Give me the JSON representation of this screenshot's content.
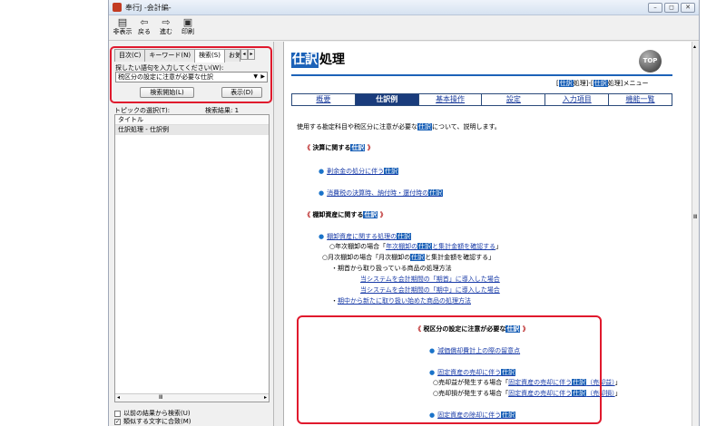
{
  "window": {
    "title": "奉行J -会計編-",
    "controls": {
      "minimize": "–",
      "restore": "◻",
      "close": "✕"
    }
  },
  "toolbar": [
    {
      "label": "非表示",
      "icon": "hide-icon",
      "glyph": "▤"
    },
    {
      "label": "戻る",
      "icon": "back-arrow-icon",
      "glyph": "⇦"
    },
    {
      "label": "進む",
      "icon": "forward-arrow-icon",
      "glyph": "⇨"
    },
    {
      "label": "印刷",
      "icon": "printer-icon",
      "glyph": "▣"
    }
  ],
  "left_pane": {
    "tabs": [
      {
        "label": "目次(C)"
      },
      {
        "label": "キーワード(N)"
      },
      {
        "label": "検索(S)"
      },
      {
        "label": "お気"
      }
    ],
    "tab_scroll": {
      "left": "◂",
      "right": "▸"
    },
    "search_prompt": "探したい語句を入力してください(W):",
    "search_value": "税区分の設定に注意が必要な仕訳",
    "combo_arrow": "▼",
    "combo_side": "▶",
    "search_start_button": "検索開始(L)",
    "display_button": "表示(D)",
    "topic_select_label": "トピックの選択(T):",
    "result_count": "検索結果: 1",
    "list_header": "タイトル",
    "results": [
      "仕訳処理 - 仕訳例"
    ],
    "hscroll": {
      "left": "◂",
      "middle": "Ⅲ",
      "right": "▸"
    },
    "check_prev": "以前の結果から検索(U)",
    "check_similar": "類似する文字に合致(M)",
    "check_prev_mark": "",
    "check_similar_mark": "✓"
  },
  "page": {
    "title_highlight": "仕訳",
    "title_rest": "処理",
    "top_icon": "TOP",
    "crumb": {
      "open": "[",
      "hl1": "仕訳",
      "mid": "処理]-[",
      "hl2": "仕訳",
      "close": "処理]メニュー"
    },
    "nav_tabs": [
      "概要",
      "仕訳例",
      "基本操作",
      "設定",
      "入力項目",
      "機能一覧"
    ],
    "intro": {
      "pre": "使用する勘定科目や税区分に注意が必要な",
      "hl": "仕訳",
      "post": "について、説明します。"
    },
    "sec1": {
      "open": "《",
      "title": "決算に関する",
      "hl": "仕訳",
      "close": "》"
    },
    "sec1_links": [
      {
        "bullet": "●",
        "pre": "剰余金の処分に伴う",
        "hl": "仕訳",
        "post": ""
      },
      {
        "bullet": "●",
        "pre": "消費税の決算時、納付時・還付時の",
        "hl": "仕訳",
        "post": ""
      }
    ],
    "sec2": {
      "open": "《",
      "title": "棚卸資産に関する",
      "hl": "仕訳",
      "close": "》"
    },
    "sec2_items": {
      "main": {
        "bullet": "●",
        "pre": "棚卸資産に関する処理の",
        "hl": "仕訳",
        "post": ""
      },
      "annual": {
        "pre": "○年次棚卸の場合「",
        "link_pre": "年次棚卸の",
        "hl": "仕訳",
        "link_post": "と集計金額を確認する",
        "post": "」"
      },
      "monthly": {
        "pre": "○月次棚卸の場合「月次棚卸の",
        "hl": "仕訳",
        "post": "と集計金額を確認する」"
      },
      "begin": "・期首から取り扱っている商品の処理方法",
      "intro_start": "当システムを会計期間の「期首」に導入した場合",
      "intro_mid": "当システムを会計期間の「期中」に導入した場合",
      "new_items": {
        "pre": "・",
        "link": "期中から新たに取り扱い始めた商品の処理方法"
      }
    },
    "sec3": {
      "open": "《",
      "title": "税区分の設定に注意が必要な",
      "hl": "仕訳",
      "close": "》"
    },
    "sec3_items": {
      "depreciation": {
        "bullet": "●",
        "text": "減価償却費計上の際の留意点"
      },
      "sale": {
        "bullet": "●",
        "pre": "固定資産の売却に伴う",
        "hl": "仕訳",
        "post": ""
      },
      "gain": {
        "pre": "○売却益が発生する場合「",
        "link_pre": "固定資産の売却に伴う",
        "hl": "仕訳",
        "link_post": "（売却益）",
        "post": "」"
      },
      "loss": {
        "pre": "○売却損が発生する場合「",
        "link_pre": "固定資産の売却に伴う",
        "hl": "仕訳",
        "link_post": "（売却損）",
        "post": "」"
      },
      "disposal": {
        "bullet": "●",
        "pre": "固定資産の除却に伴う",
        "hl": "仕訳",
        "post": ""
      }
    },
    "scroll": {
      "up": "▴",
      "mid": "Ⅲ"
    }
  },
  "colors": {
    "accent_blue": "#1c62b8",
    "highlight_red": "#e0192d",
    "link": "#1a3ca8"
  }
}
